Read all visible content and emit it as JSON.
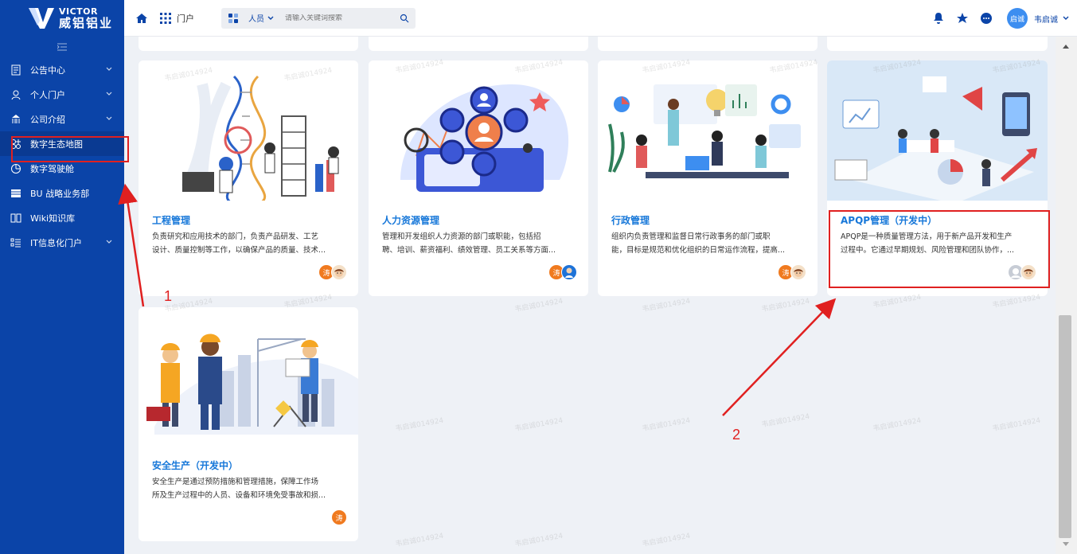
{
  "sidebar": {
    "logo_en": "VICTOR",
    "logo_cn": "威铝铝业",
    "collapse_icon": "menu-fold-icon",
    "items": [
      {
        "label": "公告中心",
        "icon": "notice-icon",
        "has_arrow": true
      },
      {
        "label": "个人门户",
        "icon": "user-icon",
        "has_arrow": true
      },
      {
        "label": "公司介绍",
        "icon": "building-icon",
        "has_arrow": true
      },
      {
        "label": "数字生态地图",
        "icon": "apps-icon",
        "has_arrow": false
      },
      {
        "label": "数字驾驶舱",
        "icon": "dashboard-icon",
        "has_arrow": false
      },
      {
        "label": "BU 战略业务部",
        "icon": "table-icon",
        "has_arrow": false
      },
      {
        "label": "Wiki知识库",
        "icon": "book-icon",
        "has_arrow": false
      },
      {
        "label": "IT信息化门户",
        "icon": "list-icon",
        "has_arrow": true
      }
    ]
  },
  "header": {
    "portal_label": "门户",
    "search": {
      "category": "人员",
      "placeholder": "请输入关键词搜索"
    },
    "user": {
      "avatar_text": "启诚",
      "name": "韦启诚"
    }
  },
  "cards": [
    {
      "title": "工程管理",
      "desc_lines": [
        "负责研究和应用技术的部门，负责产品研发、工艺",
        "设计、质量控制等工作，以确保产品的质量、技术..."
      ],
      "avatars": [
        "涛",
        "face"
      ]
    },
    {
      "title": "人力资源管理",
      "desc_lines": [
        "管理和开发组织人力资源的部门或职能，包括招",
        "聘、培训、薪资福利、绩效管理、员工关系等方面..."
      ],
      "avatars": [
        "涛",
        "photo"
      ]
    },
    {
      "title": "行政管理",
      "desc_lines": [
        "组织内负责管理和监督日常行政事务的部门或职",
        "能，目标是规范和优化组织的日常运作流程，提高..."
      ],
      "avatars": [
        "涛",
        "face"
      ]
    },
    {
      "title": "APQP管理（开发中）",
      "desc_lines": [
        "APQP是一种质量管理方法，用于新产品开发和生产",
        "过程中。它通过早期规划、风险管理和团队协作，..."
      ],
      "avatars": [
        "gray",
        "face"
      ]
    },
    {
      "title": "安全生产（开发中）",
      "desc_lines": [
        "安全生产是通过预防措施和管理措施，保障工作场",
        "所及生产过程中的人员、设备和环境免受事故和损..."
      ],
      "avatars": [
        "涛"
      ]
    }
  ],
  "annotations": {
    "label_1": "1",
    "label_2": "2",
    "color": "#e02020"
  },
  "watermark": "韦启诚014924",
  "colors": {
    "sidebar": "#0b44a8",
    "link": "#1677d9",
    "avatar_orange": "#f07a1f"
  }
}
